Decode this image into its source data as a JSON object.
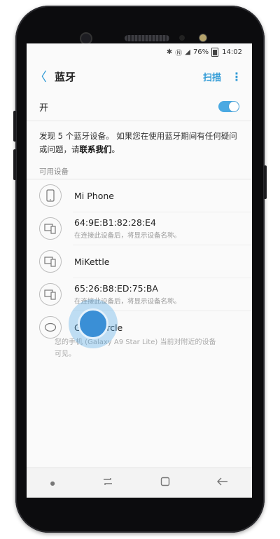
{
  "status": {
    "battery": "76%",
    "time": "14:02"
  },
  "appbar": {
    "title": "蓝牙",
    "scan_label": "扫描",
    "more_glyph": "⋮",
    "back_glyph": "〈"
  },
  "toggle": {
    "label": "开",
    "on": true
  },
  "description": {
    "text": "发现 5 个蓝牙设备。 如果您在使用蓝牙期间有任何疑问或问题，请",
    "link": "联系我们",
    "end": "。"
  },
  "section_label": "可用设备",
  "devices": [
    {
      "name": "Mi Phone",
      "sub": "",
      "icon": "phone-icon"
    },
    {
      "name": "64:9E:B1:82:28:E4",
      "sub": "在连接此设备后，将显示设备名称。",
      "icon": "devices-icon"
    },
    {
      "name": "MiKettle",
      "sub": "",
      "icon": "devices-icon"
    },
    {
      "name": "65:26:B8:ED:75:BA",
      "sub": "在连接此设备后，将显示设备名称。",
      "icon": "devices-icon"
    },
    {
      "name": "Gear Circle",
      "sub": "",
      "icon": "headset-icon"
    }
  ],
  "hint": "您的手机 (Galaxy A9 Star Lite) 当前对附近的设备可见。",
  "colors": {
    "accent": "#2f9ad6",
    "switch_on": "#4aa9e2"
  }
}
